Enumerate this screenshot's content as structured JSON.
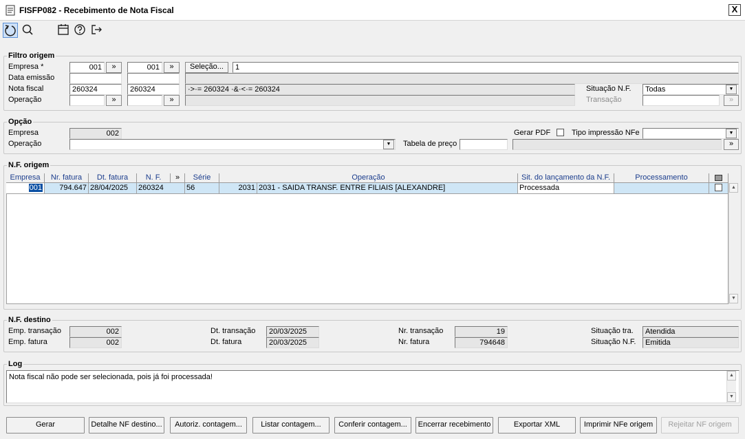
{
  "window": {
    "title": "FISFP082 - Recebimento de Nota Fiscal",
    "close_label": "X"
  },
  "toolbar": {
    "icons": [
      "refresh-icon",
      "search-icon",
      "calendar-icon",
      "help-icon",
      "exit-icon"
    ]
  },
  "filtro": {
    "legend": "Filtro origem",
    "empresa_label": "Empresa *",
    "empresa_from": "001",
    "empresa_to": "001",
    "nav_symbol": "»",
    "selecao_label": "Seleção...",
    "selecao_value": "1",
    "data_emissao_label": "Data emissão",
    "nota_fiscal_label": "Nota fiscal",
    "nota_from": "260324",
    "nota_to": "260324",
    "nota_expr": "·>·= 260324 ·&·<·= 260324",
    "operacao_label": "Operação",
    "situacao_nf_label": "Situação N.F.",
    "situacao_nf_value": "Todas",
    "transacao_label": "Transação"
  },
  "opcao": {
    "legend": "Opção",
    "empresa_label": "Empresa",
    "empresa_value": "002",
    "gerar_pdf_label": "Gerar PDF",
    "tipo_impressao_label": "Tipo impressão NFe",
    "operacao_label": "Operação",
    "tabela_preco_label": "Tabela de preço",
    "nav_symbol": "»"
  },
  "nf_origem": {
    "legend": "N.F. origem",
    "columns": {
      "empresa": "Empresa",
      "nr_fatura": "Nr. fatura",
      "dt_fatura": "Dt. fatura",
      "nf": "N. F.",
      "nav": "»",
      "serie": "Série",
      "operacao": "Operação",
      "sit_lancamento": "Sit. do lançamento da N.F.",
      "processamento": "Processamento"
    },
    "rows": [
      {
        "empresa": "001",
        "nr_fatura": "794.647",
        "dt_fatura": "28/04/2025",
        "nf": "260324",
        "serie": "56",
        "operacao_code": "2031",
        "operacao_desc": "2031 - SAIDA TRANSF. ENTRE FILIAIS [ALEXANDRE]",
        "sit_lancamento": "Processada",
        "processamento": ""
      }
    ]
  },
  "nf_destino": {
    "legend": "N.F. destino",
    "emp_transacao_label": "Emp. transação",
    "emp_transacao": "002",
    "emp_fatura_label": "Emp. fatura",
    "emp_fatura": "002",
    "dt_transacao_label": "Dt. transação",
    "dt_transacao": "20/03/2025",
    "dt_fatura_label": "Dt. fatura",
    "dt_fatura": "20/03/2025",
    "nr_transacao_label": "Nr. transação",
    "nr_transacao": "19",
    "nr_fatura_label": "Nr. fatura",
    "nr_fatura": "794648",
    "situacao_tra_label": "Situação tra.",
    "situacao_tra": "Atendida",
    "situacao_nf_label": "Situação N.F.",
    "situacao_nf": "Emitida"
  },
  "log": {
    "legend": "Log",
    "message": "Nota fiscal não pode ser selecionada, pois já foi processada!"
  },
  "buttons": {
    "gerar": "Gerar",
    "detalhe_nf_destino": "Detalhe NF destino...",
    "autoriz_contagem": "Autoriz. contagem...",
    "listar_contagem": "Listar contagem...",
    "conferir_contagem": "Conferir contagem...",
    "encerrar_recebimento": "Encerrar recebimento",
    "exportar_xml": "Exportar XML",
    "imprimir_nfe_origem": "Imprimir NFe origem",
    "rejeitar_nf_origem": "Rejeitar NF origem"
  }
}
